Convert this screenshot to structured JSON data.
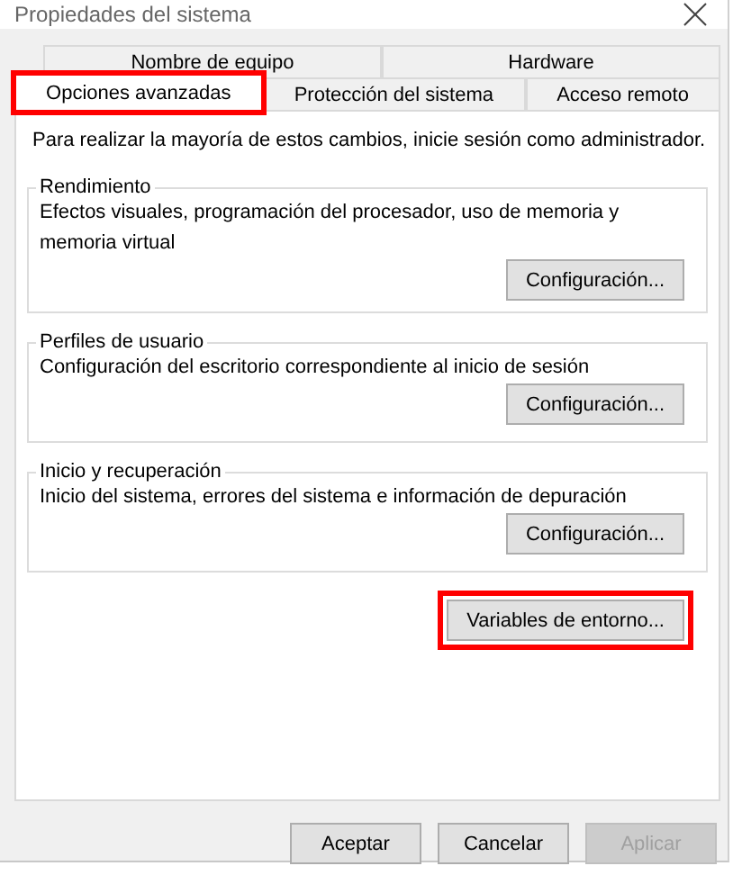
{
  "window": {
    "title": "Propiedades del sistema"
  },
  "tab_rows": [
    [
      {
        "label": "Nombre de equipo",
        "selected": false,
        "highlighted": false
      },
      {
        "label": "Hardware",
        "selected": false,
        "highlighted": false
      }
    ],
    [
      {
        "label": "Opciones avanzadas",
        "selected": true,
        "highlighted": true
      },
      {
        "label": "Protección del sistema",
        "selected": false,
        "highlighted": false
      },
      {
        "label": "Acceso remoto",
        "selected": false,
        "highlighted": false
      }
    ]
  ],
  "notice": "Para realizar la mayoría de estos cambios, inicie sesión como administrador.",
  "groups": [
    {
      "title": "Rendimiento",
      "text": "Efectos visuales, programación del procesador, uso de memoria y memoria virtual",
      "button": "Configuración..."
    },
    {
      "title": "Perfiles de usuario",
      "text": "Configuración del escritorio correspondiente al inicio de sesión",
      "button": "Configuración..."
    },
    {
      "title": "Inicio y recuperación",
      "text": "Inicio del sistema, errores del sistema e información de depuración",
      "button": "Configuración..."
    }
  ],
  "env_button": {
    "label": "Variables de entorno...",
    "highlighted": true
  },
  "footer_buttons": [
    {
      "label": "Aceptar",
      "disabled": false
    },
    {
      "label": "Cancelar",
      "disabled": false
    },
    {
      "label": "Aplicar",
      "disabled": true
    }
  ]
}
